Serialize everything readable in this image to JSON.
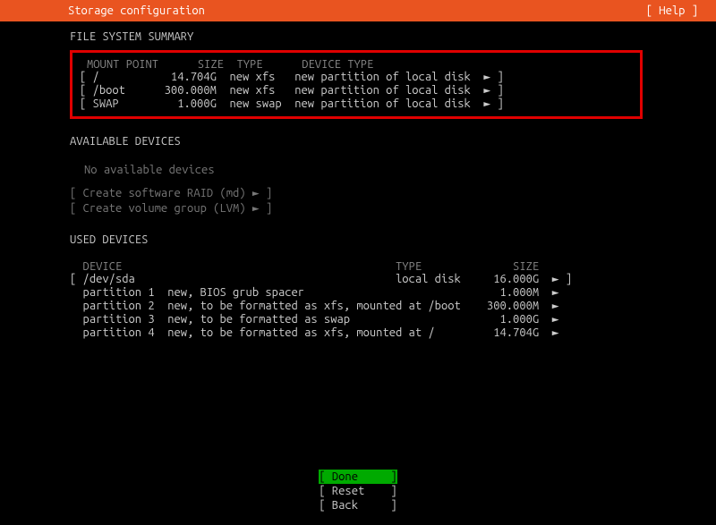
{
  "header": {
    "title": "Storage configuration",
    "help": "[ Help ]"
  },
  "fs_summary": {
    "title": "FILE SYSTEM SUMMARY",
    "columns": {
      "mount": "MOUNT POINT",
      "size": "SIZE",
      "type": "TYPE",
      "devtype": "DEVICE TYPE"
    },
    "rows": [
      {
        "mount": "/",
        "size": "14.704G",
        "type": "new xfs",
        "devtype": "new partition of local disk"
      },
      {
        "mount": "/boot",
        "size": "300.000M",
        "type": "new xfs",
        "devtype": "new partition of local disk"
      },
      {
        "mount": "SWAP",
        "size": "1.000G",
        "type": "new swap",
        "devtype": "new partition of local disk"
      }
    ]
  },
  "available": {
    "title": "AVAILABLE DEVICES",
    "empty": "No available devices",
    "raid": "[ Create software RAID (md) ► ]",
    "lvm": "[ Create volume group (LVM) ► ]"
  },
  "used": {
    "title": "USED DEVICES",
    "columns": {
      "device": "DEVICE",
      "type": "TYPE",
      "size": "SIZE"
    },
    "disk": {
      "name": "/dev/sda",
      "type": "local disk",
      "size": "16.000G"
    },
    "parts": [
      {
        "name": "partition 1",
        "desc": "new, BIOS grub spacer",
        "size": "1.000M"
      },
      {
        "name": "partition 2",
        "desc": "new, to be formatted as xfs, mounted at /boot",
        "size": "300.000M"
      },
      {
        "name": "partition 3",
        "desc": "new, to be formatted as swap",
        "size": "1.000G"
      },
      {
        "name": "partition 4",
        "desc": "new, to be formatted as xfs, mounted at /",
        "size": "14.704G"
      }
    ]
  },
  "buttons": {
    "done": "Done",
    "reset": "Reset",
    "back": "Back"
  }
}
